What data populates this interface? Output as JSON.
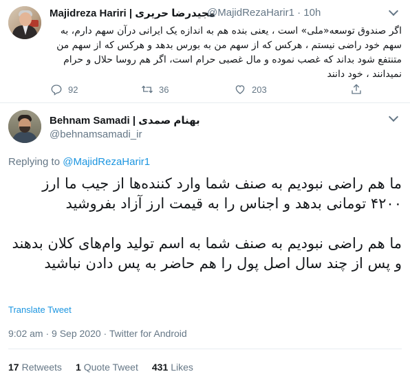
{
  "parent_tweet": {
    "name": "Majidreza Hariri | مجیدرضا حریری",
    "handle": "@MajidRezaHarir1 · 10h",
    "text": "اگر صندوق توسعه«ملی» است ، یعنی بنده هم به اندازه یک ایرانی درآن سهم دارم، به سهم خود راضی نیستم ، هرکس که از سهم من به بورس بدهد و هرکس که از سهم من متنتفع شود بداند که غصب نموده و مال غصبی حرام است، اگر هم روسا حلال و حرام نمیدانند ، خود دانند",
    "reply_count": "92",
    "retweet_count": "36",
    "like_count": "203",
    "icons": {
      "reply": "reply-icon",
      "retweet": "retweet-icon",
      "like": "heart-icon",
      "share": "share-icon",
      "more": "chevron-down-icon"
    }
  },
  "main_tweet": {
    "name": "Behnam Samadi | بهنام صمدی",
    "handle": "@behnamsamadi_ir",
    "replying_prefix": "Replying to",
    "replying_to": "@MajidRezaHarir1",
    "paragraph_1": "ما هم راضی نبودیم به صنف شما وارد کننده‌ها از جیب ما ارز ۴۲۰۰ تومانی بدهد و اجناس را به قیمت ارز آزاد بفروشید",
    "paragraph_2": "ما هم راضی نبودیم به صنف شما به اسم تولید وام‌های کلان بدهند و پس از چند سال اصل پول را هم حاضر به پس دادن نباشید",
    "translate_label": "Translate Tweet",
    "timestamp": "9:02 am · 9 Sep 2020 · Twitter for Android",
    "retweets_count": "17",
    "retweets_label": "Retweets",
    "quotes_count": "1",
    "quotes_label": "Quote Tweet",
    "likes_count": "431",
    "likes_label": "Likes"
  },
  "colors": {
    "text": "#14171a",
    "secondary": "#657786",
    "link": "#1b95e0",
    "divider": "#e6ecf0"
  }
}
